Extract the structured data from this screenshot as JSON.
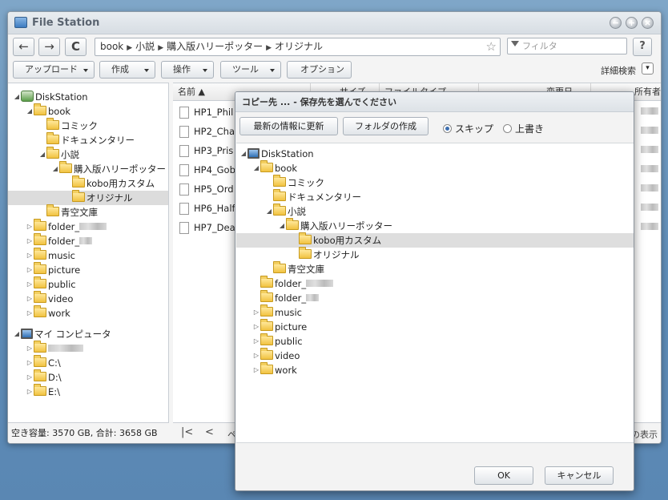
{
  "window": {
    "title": "File Station",
    "controls": [
      "−",
      "+",
      "×"
    ]
  },
  "toolbar": {
    "back": "←",
    "forward": "→",
    "refresh": "C",
    "path": [
      "book",
      "小説",
      "購入版ハリーポッター",
      "オリジナル"
    ],
    "filter_placeholder": "フィルタ",
    "help": "?",
    "buttons": [
      "アップロード",
      "作成",
      "操作",
      "ツール"
    ],
    "option_button": "オプション",
    "advanced_search": "詳細検索",
    "advanced_toggle": "▾"
  },
  "sidebar": {
    "root": "DiskStation",
    "book": "book",
    "comic": "コミック",
    "documentary": "ドキュメンタリー",
    "novel": "小説",
    "harry": "購入版ハリーポッター",
    "kobo": "kobo用カスタム",
    "original": "オリジナル",
    "aozora": "青空文庫",
    "folder1": "folder_",
    "folder2": "folder_",
    "music": "music",
    "picture": "picture",
    "public": "public",
    "video": "video",
    "work": "work",
    "my_computer": "マイ コンピュータ",
    "drive_c": "C:\\",
    "drive_d": "D:\\",
    "drive_e": "E:\\"
  },
  "status": "空き容量: 3570 GB, 合計: 3658 GB",
  "grid": {
    "columns": [
      "名前 ▲",
      "サイズ",
      "ファイルタイプ",
      "変更日",
      "所有者"
    ],
    "files": [
      "HP1_Phil",
      "HP2_Cha",
      "HP3_Pris",
      "HP4_Gob",
      "HP5_Ord",
      "HP6_Half",
      "HP7_Dea"
    ],
    "pager_first": "|<",
    "pager_prev": "<",
    "pager_text": "ペ",
    "display_text": "の表示"
  },
  "dialog": {
    "title": "コピー先 ... - 保存先を選んでください",
    "refresh_button": "最新の情報に更新",
    "create_folder_button": "フォルダの作成",
    "skip_label": "スキップ",
    "overwrite_label": "上書き",
    "ok": "OK",
    "cancel": "キャンセル"
  }
}
